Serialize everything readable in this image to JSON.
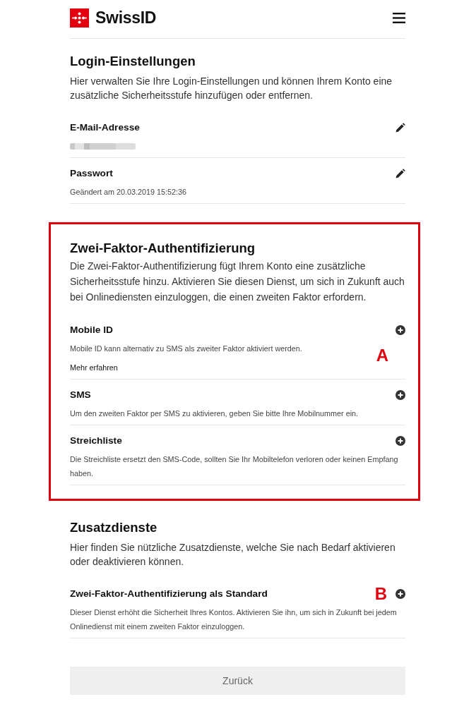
{
  "header": {
    "brand": "SwissID"
  },
  "sections": [
    {
      "title": "Login-Einstellungen",
      "description": "Hier verwalten Sie Ihre Login-Einstellungen und können Ihrem Konto eine zusätzliche Sicherheitsstufe hinzufügen oder entfernen.",
      "highlighted": false,
      "items": [
        {
          "title": "E-Mail-Adresse",
          "kind": "edit",
          "redacted_value": true
        },
        {
          "title": "Passwort",
          "kind": "edit",
          "description": "Geändert am 20.03.2019 15:52:36"
        }
      ]
    },
    {
      "title": "Zwei-Faktor-Authentifizierung",
      "description": "Die Zwei-Faktor-Authentifizierung fügt Ihrem Konto eine zusätzliche Sicherheitsstufe hinzu. Aktivieren Sie diesen Dienst, um sich in Zukunft auch bei Onlinediensten einzuloggen, die einen zweiten Faktor erfordern.",
      "highlighted": true,
      "annotation": "A",
      "items": [
        {
          "title": "Mobile ID",
          "kind": "add",
          "description": "Mobile ID kann alternativ zu SMS als zweiter Faktor aktiviert werden.",
          "link": "Mehr erfahren"
        },
        {
          "title": "SMS",
          "kind": "add",
          "description": "Um den zweiten Faktor per SMS zu aktivieren, geben Sie bitte Ihre Mobilnummer ein."
        },
        {
          "title": "Streichliste",
          "kind": "add",
          "description": "Die Streichliste ersetzt den SMS-Code, sollten Sie Ihr Mobiltelefon verloren oder keinen Empfang haben."
        }
      ]
    },
    {
      "title": "Zusatzdienste",
      "description": "Hier finden Sie nützliche Zusatzdienste, welche Sie nach Bedarf aktivieren oder deaktivieren können.",
      "highlighted": false,
      "items": [
        {
          "title": "Zwei-Faktor-Authentifizierung als Standard",
          "kind": "add",
          "annotation": "B",
          "description": "Dieser Dienst erhöht die Sicherheit Ihres Kontos. Aktivieren Sie ihn, um sich in Zukunft bei jedem Onlinedienst mit einem zweiten Faktor einzuloggen."
        }
      ]
    }
  ],
  "back_button": {
    "label": "Zurück"
  }
}
